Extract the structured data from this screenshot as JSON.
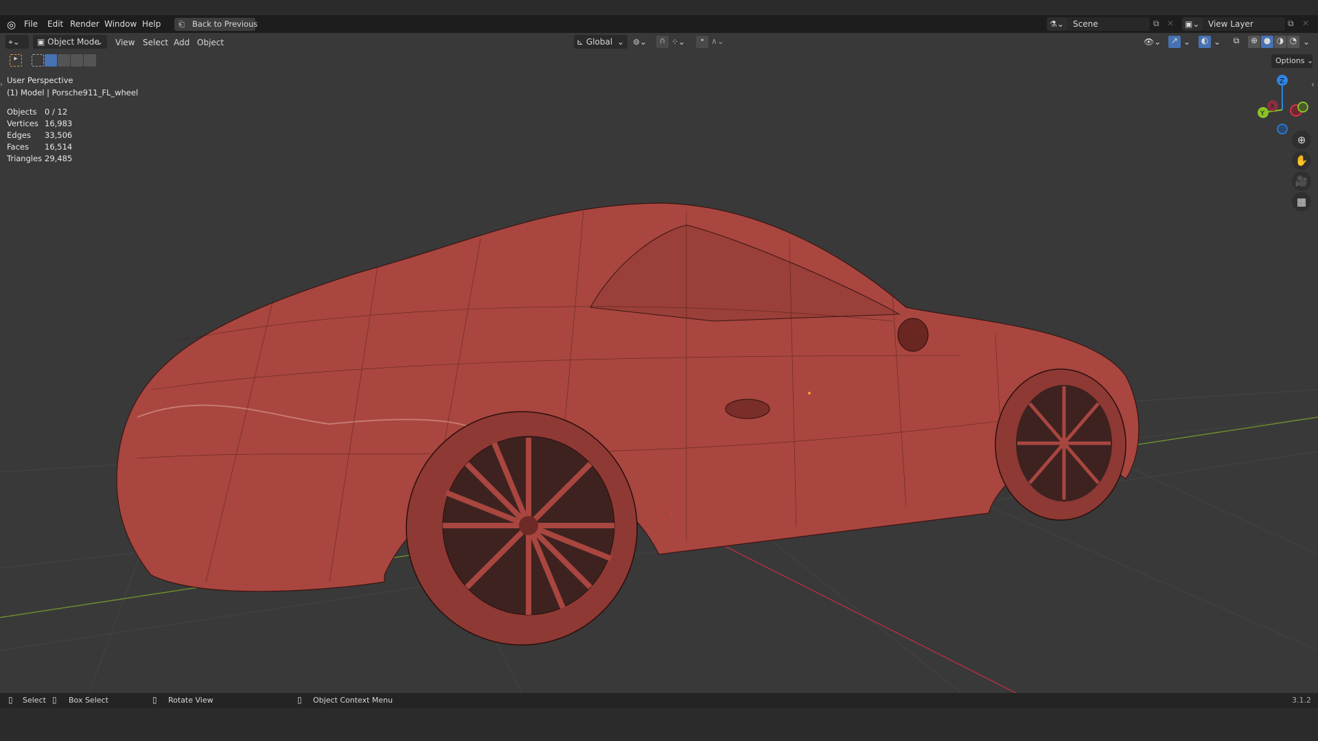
{
  "menu": {
    "items": [
      "File",
      "Edit",
      "Render",
      "Window",
      "Help"
    ],
    "back_button": "Back to Previous"
  },
  "scene": {
    "label": "Scene",
    "view_layer": "View Layer"
  },
  "header": {
    "mode": "Object Mode",
    "menus": [
      "View",
      "Select",
      "Add",
      "Object"
    ],
    "orientation": "Global",
    "options": "Options"
  },
  "overlay": {
    "view_name": "User Perspective",
    "object": "(1) Model | Porsche911_FL_wheel",
    "stats": [
      {
        "label": "Objects",
        "value": "0 / 12"
      },
      {
        "label": "Vertices",
        "value": "16,983"
      },
      {
        "label": "Edges",
        "value": "33,506"
      },
      {
        "label": "Faces",
        "value": "16,514"
      },
      {
        "label": "Triangles",
        "value": "29,485"
      }
    ]
  },
  "gizmo": {
    "x": "X",
    "y": "Y",
    "z": "Z"
  },
  "statusbar": {
    "select": "Select",
    "box_select": "Box Select",
    "rotate": "Rotate View",
    "context": "Object Context Menu",
    "version": "3.1.2"
  },
  "colors": {
    "accent": "#4772b3",
    "model": "#a8463f",
    "x_axis": "#d63445",
    "y_axis": "#8bc325",
    "z_axis": "#2f84e3"
  }
}
